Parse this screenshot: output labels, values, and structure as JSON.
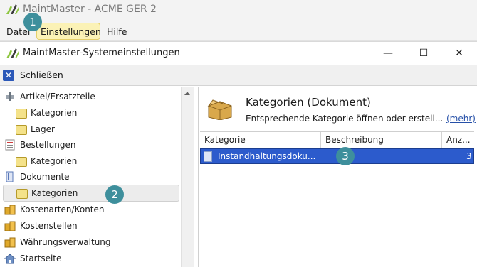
{
  "app": {
    "title": "MaintMaster - ACME GER 2"
  },
  "menu": {
    "items": [
      "Datei",
      "Einstellungen",
      "Hilfe"
    ]
  },
  "badges": [
    "1",
    "2",
    "3"
  ],
  "dialog": {
    "title": "MaintMaster-Systemeinstellungen",
    "toolbar_close": "Schließen",
    "window_buttons": {
      "minimize": "—",
      "maximize": "☐",
      "close": "✕"
    }
  },
  "tree": {
    "items": [
      {
        "label": "Artikel/Ersatzteile",
        "icon": "parts-icon",
        "level": 0
      },
      {
        "label": "Kategorien",
        "icon": "folder-icon",
        "level": 1
      },
      {
        "label": "Lager",
        "icon": "folder-icon",
        "level": 1
      },
      {
        "label": "Bestellungen",
        "icon": "order-icon",
        "level": 0
      },
      {
        "label": "Kategorien",
        "icon": "folder-icon",
        "level": 1
      },
      {
        "label": "Dokumente",
        "icon": "documents-icon",
        "level": 0
      },
      {
        "label": "Kategorien",
        "icon": "folder-icon",
        "level": 1,
        "selected": true
      },
      {
        "label": "Kostenarten/Konten",
        "icon": "coins-icon",
        "level": 0
      },
      {
        "label": "Kostenstellen",
        "icon": "coins-icon",
        "level": 0
      },
      {
        "label": "Währungsverwaltung",
        "icon": "coins-icon",
        "level": 0
      },
      {
        "label": "Startseite",
        "icon": "home-icon",
        "level": 0
      }
    ]
  },
  "panel": {
    "title": "Kategorien (Dokument)",
    "subtitle": "Entsprechende Kategorie öffnen oder erstell...",
    "more_link": "(mehr)"
  },
  "grid": {
    "columns": [
      "Kategorie",
      "Beschreibung",
      "Anz..."
    ],
    "rows": [
      {
        "kategorie": "Instandhaltungsdoku...",
        "beschreibung": "",
        "anzahl": "3",
        "selected": true
      }
    ]
  },
  "colors": {
    "badge": "#3e8f9c",
    "selection": "#2c5bcc",
    "menu_highlight": "#fbf2b6"
  }
}
